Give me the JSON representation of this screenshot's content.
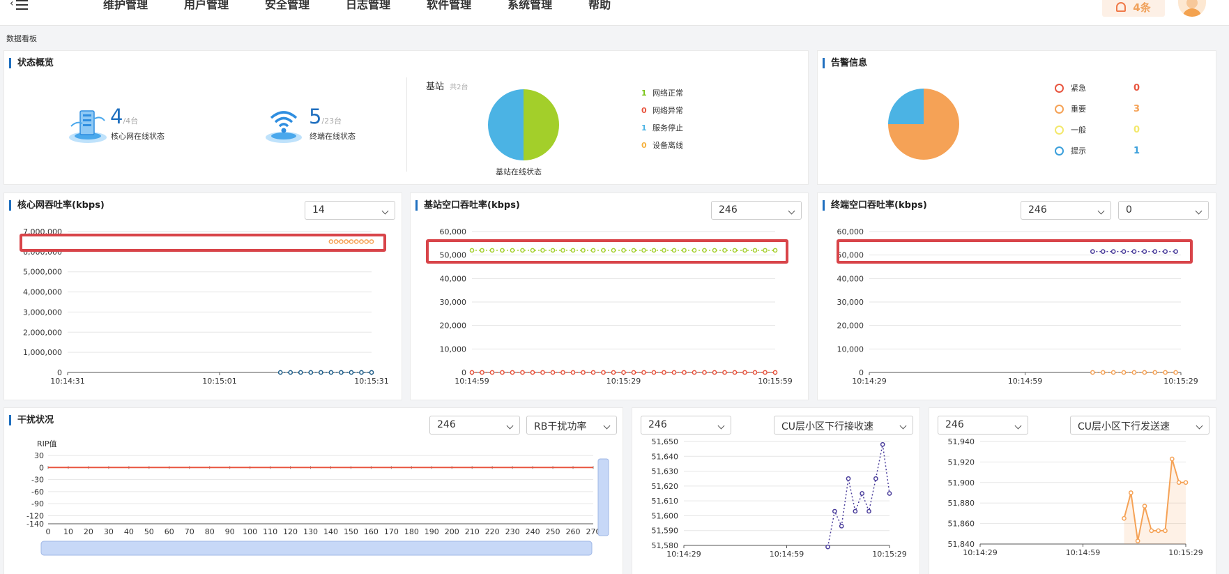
{
  "header": {
    "menu_items": [
      "维护管理",
      "用户管理",
      "安全管理",
      "日志管理",
      "软件管理",
      "系统管理",
      "帮助"
    ],
    "alarm_count": "4条"
  },
  "breadcrumb": "数据看板",
  "status_overview": {
    "title": "状态概览",
    "core": {
      "value": "4",
      "of": "/4台",
      "label": "核心网在线状态"
    },
    "terminal": {
      "value": "5",
      "of": "/23台",
      "label": "终端在线状态"
    },
    "base_station": {
      "title": "基站",
      "count": "共2台",
      "caption": "基站在线状态",
      "legend": [
        {
          "count": "1",
          "label": "网络正常",
          "color": "#7cc51c"
        },
        {
          "count": "0",
          "label": "网络异常",
          "color": "#e8553f"
        },
        {
          "count": "1",
          "label": "服务停止",
          "color": "#4bb3e4"
        },
        {
          "count": "0",
          "label": "设备离线",
          "color": "#f5b240"
        }
      ]
    }
  },
  "alarm_info": {
    "title": "告警信息",
    "legend": [
      {
        "label": "紧急",
        "count": "0",
        "color": "#e8553f"
      },
      {
        "label": "重要",
        "count": "3",
        "color": "#f5a256"
      },
      {
        "label": "一般",
        "count": "0",
        "color": "#f3e86b"
      },
      {
        "label": "提示",
        "count": "1",
        "color": "#3b9fdb"
      }
    ]
  },
  "core_throughput": {
    "title": "核心网吞吐率(kbps)",
    "select": "14"
  },
  "bs_throughput": {
    "title": "基站空口吞吐率(kbps)",
    "select": "246"
  },
  "term_throughput": {
    "title": "终端空口吞吐率(kbps)",
    "select1": "246",
    "select2": "0"
  },
  "interference": {
    "title": "干扰状况",
    "select1": "246",
    "select2": "RB干扰功率",
    "ylabel": "RIP值"
  },
  "dl_receive": {
    "select1": "246",
    "select2": "CU层小区下行接收速"
  },
  "dl_send": {
    "select1": "246",
    "select2": "CU层小区下行发送速"
  },
  "chart_data": [
    {
      "type": "pie",
      "name": "base_station_online",
      "values": [
        {
          "label": "网络正常",
          "value": 1,
          "color": "#a3cf2a"
        },
        {
          "label": "服务停止",
          "value": 1,
          "color": "#4bb3e4"
        }
      ]
    },
    {
      "type": "pie",
      "name": "alarms",
      "values": [
        {
          "label": "重要",
          "value": 3,
          "color": "#f5a256"
        },
        {
          "label": "提示",
          "value": 1,
          "color": "#4bb3e4"
        }
      ]
    },
    {
      "type": "line",
      "name": "core_throughput",
      "y_ticks": [
        0,
        1000000,
        2000000,
        3000000,
        4000000,
        5000000,
        6000000,
        7000000
      ],
      "ylim": [
        0,
        7000000
      ],
      "x_ticks": [
        "10:14:31",
        "10:15:01",
        "10:15:31"
      ],
      "x_range": [
        0,
        60
      ],
      "series": [
        {
          "color": "#f5a256",
          "x": [
            52,
            53,
            54,
            55,
            56,
            57,
            58,
            59,
            60
          ],
          "y": [
            6500000,
            6500000,
            6500000,
            6500000,
            6500000,
            6500000,
            6500000,
            6500000,
            6500000
          ]
        },
        {
          "color": "#1f5f8b",
          "x": [
            42,
            44,
            46,
            48,
            50,
            52,
            54,
            56,
            58,
            60
          ],
          "y": [
            0,
            0,
            0,
            0,
            0,
            0,
            0,
            0,
            0,
            0
          ]
        }
      ]
    },
    {
      "type": "line",
      "name": "bs_throughput",
      "y_ticks": [
        0,
        10000,
        20000,
        30000,
        40000,
        50000,
        60000
      ],
      "ylim": [
        0,
        60000
      ],
      "x_ticks": [
        "10:14:59",
        "10:15:29",
        "10:15:59"
      ],
      "x_range": [
        0,
        60
      ],
      "series": [
        {
          "color": "#a3cf2a",
          "from": 0,
          "to": 60,
          "step": 2,
          "y": 52000
        },
        {
          "color": "#e8553f",
          "from": 0,
          "to": 60,
          "step": 2,
          "y": 0
        }
      ]
    },
    {
      "type": "line",
      "name": "term_throughput",
      "y_ticks": [
        0,
        10000,
        20000,
        30000,
        40000,
        50000,
        60000
      ],
      "ylim": [
        0,
        60000
      ],
      "x_ticks": [
        "10:14:29",
        "10:14:59",
        "10:15:29"
      ],
      "x_range": [
        0,
        60
      ],
      "series": [
        {
          "color": "#4a3d9b",
          "from": 43,
          "to": 60,
          "step": 2,
          "y": 51500
        },
        {
          "color": "#f5a256",
          "from": 43,
          "to": 60,
          "step": 2,
          "y": 0
        }
      ]
    },
    {
      "type": "line",
      "name": "interference",
      "y_ticks": [
        30,
        0,
        -30,
        -60,
        -90,
        -120,
        -140
      ],
      "ylim": [
        -140,
        30
      ],
      "x_ticks": [
        0,
        10,
        20,
        30,
        40,
        50,
        60,
        70,
        80,
        90,
        100,
        110,
        120,
        130,
        140,
        150,
        160,
        170,
        180,
        190,
        200,
        210,
        220,
        230,
        240,
        250,
        260,
        270
      ],
      "x_range": [
        0,
        270
      ],
      "series": [
        {
          "color": "#e8553f",
          "value": 0
        }
      ]
    },
    {
      "type": "line",
      "name": "dl_receive",
      "y_ticks": [
        51580,
        51590,
        51600,
        51610,
        51620,
        51630,
        51640,
        51650
      ],
      "ylim": [
        51580,
        51650
      ],
      "x_ticks": [
        "10:14:29",
        "10:14:59",
        "10:15:29"
      ],
      "x_range": [
        0,
        60
      ],
      "series": [
        {
          "color": "#4a3d9b",
          "x": [
            42,
            44,
            46,
            48,
            50,
            52,
            54,
            56,
            58,
            60
          ],
          "y": [
            51579,
            51603,
            51593,
            51625,
            51603,
            51615,
            51603,
            51625,
            51648,
            51615
          ]
        }
      ]
    },
    {
      "type": "area",
      "name": "dl_send",
      "y_ticks": [
        51840,
        51860,
        51880,
        51900,
        51920,
        51940
      ],
      "ylim": [
        51840,
        51940
      ],
      "x_ticks": [
        "10:14:29",
        "10:14:59",
        "10:15:29"
      ],
      "x_range": [
        0,
        60
      ],
      "series": [
        {
          "color": "#f5a256",
          "x": [
            42,
            44,
            46,
            48,
            50,
            52,
            54,
            56,
            58,
            60
          ],
          "y": [
            51865,
            51890,
            51843,
            51877,
            51853,
            51853,
            51853,
            51923,
            51900,
            51900
          ]
        }
      ]
    }
  ]
}
